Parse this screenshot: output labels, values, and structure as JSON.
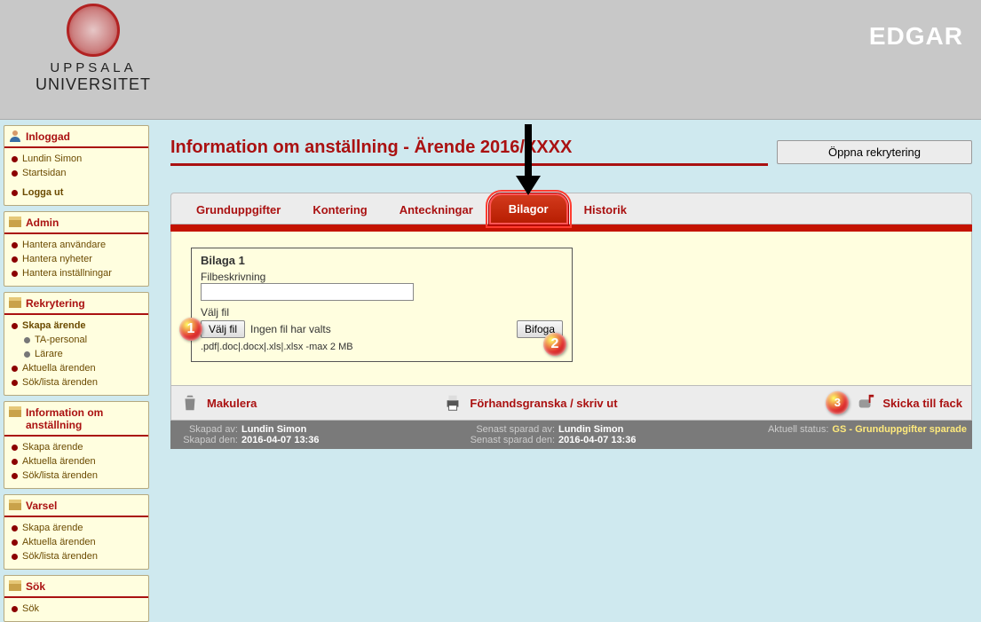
{
  "app_title": "EDGAR",
  "logo": {
    "line1": "UPPSALA",
    "line2": "UNIVERSITET"
  },
  "sidebar": {
    "sections": [
      {
        "title": "Inloggad",
        "icon": "user-icon",
        "links": [
          {
            "label": "Lundin Simon"
          },
          {
            "label": "Startsidan"
          },
          {
            "label": "Logga ut",
            "bold": true
          }
        ]
      },
      {
        "title": "Admin",
        "icon": "box-icon",
        "links": [
          {
            "label": "Hantera användare"
          },
          {
            "label": "Hantera nyheter"
          },
          {
            "label": "Hantera inställningar"
          }
        ]
      },
      {
        "title": "Rekrytering",
        "icon": "box-icon",
        "links": [
          {
            "label": "Skapa ärende",
            "bold": true
          },
          {
            "label": "TA-personal",
            "grey": true,
            "indent": true
          },
          {
            "label": "Lärare",
            "grey": true,
            "indent": true
          },
          {
            "label": "Aktuella ärenden"
          },
          {
            "label": "Sök/lista ärenden"
          }
        ]
      },
      {
        "title": "Information om anställning",
        "icon": "box-icon",
        "links": [
          {
            "label": "Skapa ärende"
          },
          {
            "label": "Aktuella ärenden"
          },
          {
            "label": "Sök/lista ärenden"
          }
        ]
      },
      {
        "title": "Varsel",
        "icon": "box-icon",
        "links": [
          {
            "label": "Skapa ärende"
          },
          {
            "label": "Aktuella ärenden"
          },
          {
            "label": "Sök/lista ärenden"
          }
        ]
      },
      {
        "title": "Sök",
        "icon": "box-icon",
        "links": [
          {
            "label": "Sök"
          }
        ]
      }
    ]
  },
  "page": {
    "title": "Information om anställning - Ärende 2016/XXXX",
    "open_button": "Öppna rekrytering"
  },
  "tabs": [
    {
      "label": "Grunduppgifter"
    },
    {
      "label": "Kontering"
    },
    {
      "label": "Anteckningar"
    },
    {
      "label": "Bilagor",
      "active": true
    },
    {
      "label": "Historik"
    }
  ],
  "bilaga": {
    "title": "Bilaga 1",
    "desc_label": "Filbeskrivning",
    "desc_value": "",
    "file_label": "Välj fil",
    "browse_label": "Välj fil",
    "nofile_label": "Ingen fil har valts",
    "hint": ".pdf|.doc|.docx|.xls|.xlsx -max 2 MB",
    "attach_label": "Bifoga"
  },
  "actions": {
    "cancel": "Makulera",
    "preview": "Förhandsgranska / skriv ut",
    "send": "Skicka till fack"
  },
  "status": {
    "created_by_lbl": "Skapad av:",
    "created_by": "Lundin Simon",
    "created_on_lbl": "Skapad den:",
    "created_on": "2016-04-07 13:36",
    "saved_by_lbl": "Senast sparad av:",
    "saved_by": "Lundin Simon",
    "saved_on_lbl": "Senast sparad den:",
    "saved_on": "2016-04-07 13:36",
    "status_lbl": "Aktuell status:",
    "status_val": "GS - Grunduppgifter sparade"
  },
  "callouts": {
    "c1": "1",
    "c2": "2",
    "c3": "3"
  }
}
